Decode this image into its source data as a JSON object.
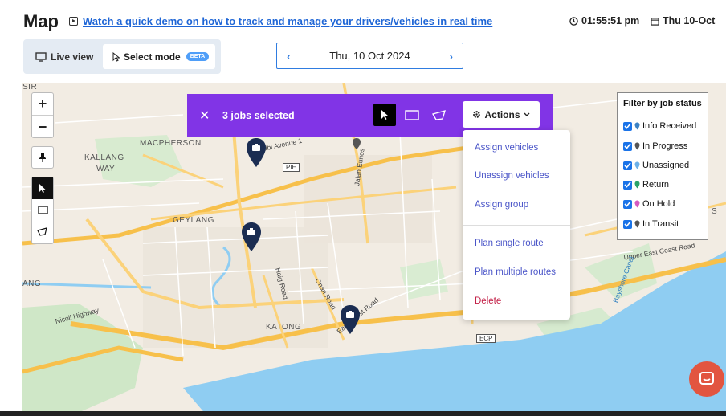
{
  "header": {
    "title": "Map",
    "demo_link": "Watch a quick demo on how to track and manage your drivers/vehicles in real time",
    "time": "01:55:51 pm",
    "date": "Thu 10-Oct"
  },
  "mode_toggle": {
    "live_label": "Live view",
    "select_label": "Select mode",
    "beta_label": "BETA"
  },
  "date_nav": {
    "label": "Thu, 10 Oct 2024"
  },
  "map_controls": {
    "zoom_in": "+",
    "zoom_out": "−"
  },
  "jobs_bar": {
    "count_label": "3 jobs selected",
    "actions_label": "Actions"
  },
  "actions_menu": {
    "items": [
      {
        "label": "Assign vehicles"
      },
      {
        "label": "Unassign vehicles"
      },
      {
        "label": "Assign group"
      },
      {
        "label": "Plan single route"
      },
      {
        "label": "Plan multiple routes"
      },
      {
        "label": "Delete"
      }
    ]
  },
  "filter": {
    "title": "Filter by job status",
    "items": [
      {
        "label": "Info Received",
        "color": "#3b82c4"
      },
      {
        "label": "In Progress",
        "color": "#555555"
      },
      {
        "label": "Unassigned",
        "color": "#6cb0e8"
      },
      {
        "label": "Return",
        "color": "#2aa36a"
      },
      {
        "label": "On Hold",
        "color": "#d45ac0"
      },
      {
        "label": "In Transit",
        "color": "#555555"
      }
    ]
  },
  "map_labels": {
    "macpherson": "MACPHERSON",
    "kallang": "KALLANG",
    "way": "WAY",
    "geylang": "GEYLANG",
    "katong": "KATONG",
    "ubi": "Ubi Avenue 1",
    "pie": "PIE",
    "jalan_eunos": "Jalan Eunos",
    "haig": "Haig Road",
    "onan": "Onan Road",
    "east_coast": "East Coast Road",
    "ecp": "ECP",
    "nicoll": "Nicoll Highway",
    "upper_east_coast": "Upper East Coast Road",
    "bayshore": "Bayshore Canal",
    "sir": "SIR",
    "ang": "ANG",
    "s": "S"
  },
  "colors": {
    "accent": "#8134e6",
    "link": "#1f66d6",
    "marker": "#1b2d52",
    "sea": "#8fcdf2"
  }
}
